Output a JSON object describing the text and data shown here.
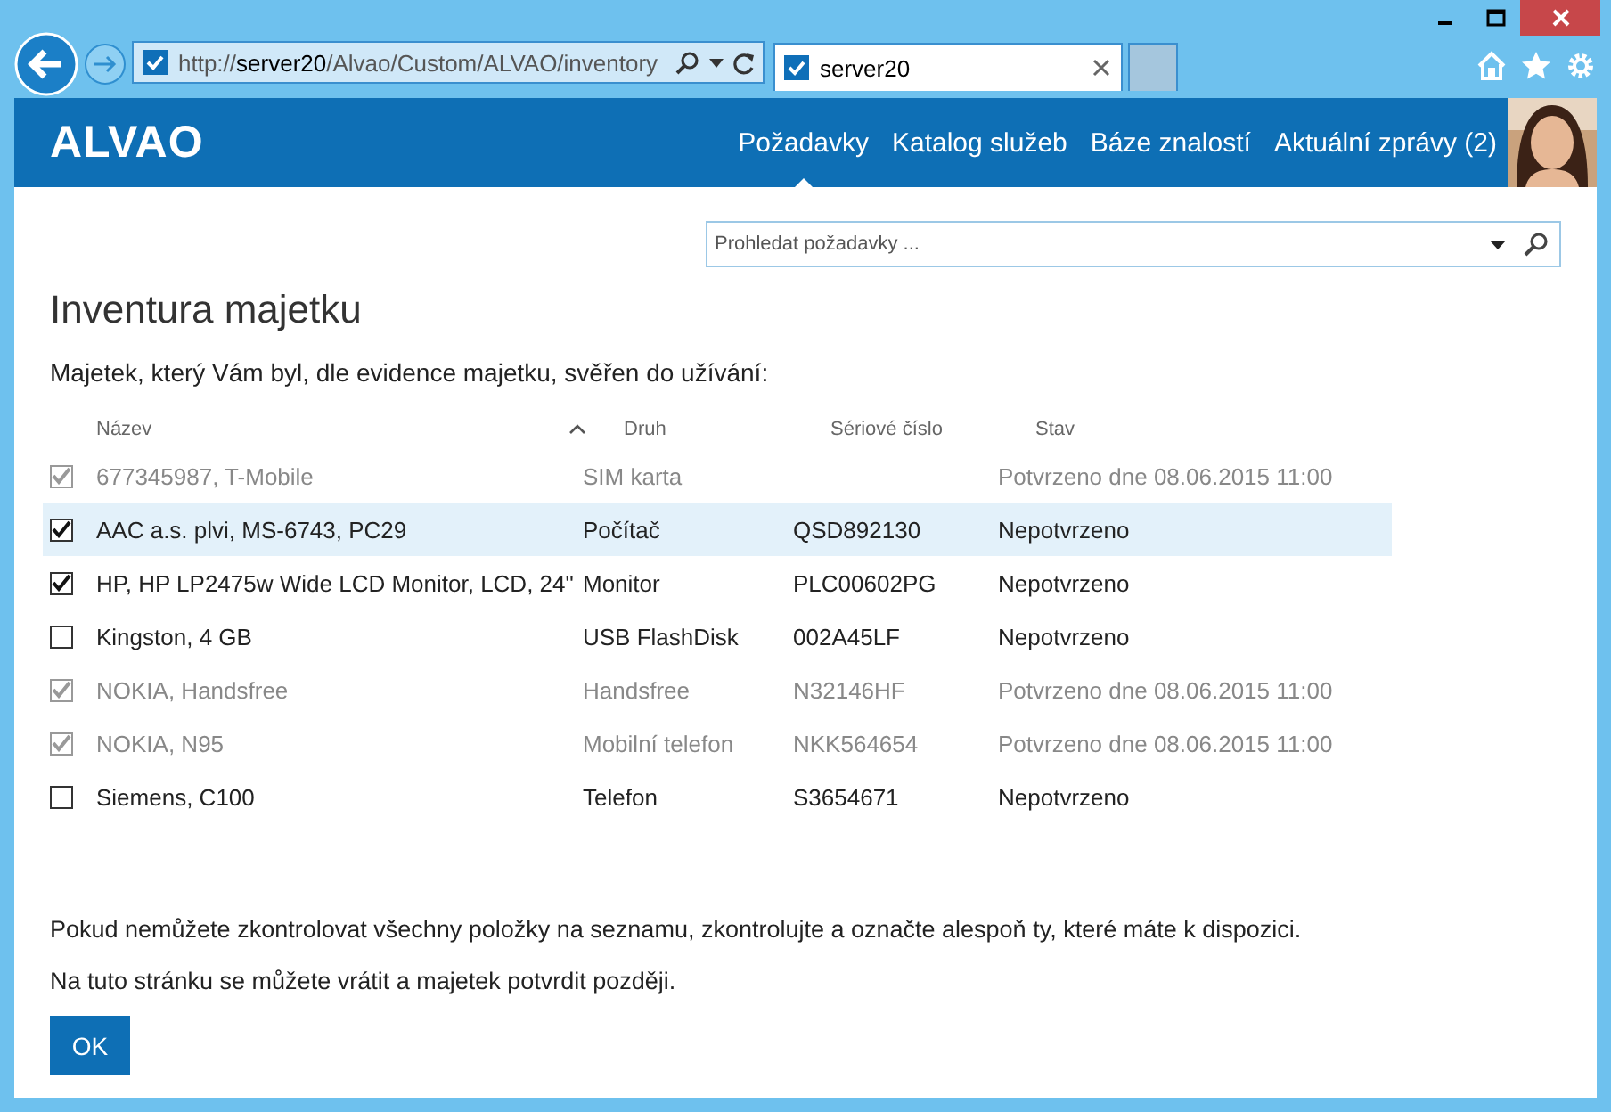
{
  "browser": {
    "address": "http://**server20**/Alvao/Custom/ALVAO/inventory",
    "tab": {
      "title": "server20",
      "selected": true
    }
  },
  "header": {
    "logo": "ALVAO",
    "nav": [
      {
        "label": "Požadavky",
        "selected": true
      },
      {
        "label": "Katalog služeb",
        "selected": false
      },
      {
        "label": "Báze znalostí",
        "selected": false
      },
      {
        "label": "Aktuální zprávy (2)",
        "selected": false
      }
    ]
  },
  "search": {
    "placeholder": "Prohledat požadavky ..."
  },
  "title": "Inventura majetku",
  "intro": "Majetek, který Vám byl, dle evidence majetku, svěřen do užívání:",
  "table": {
    "columns": [
      "Název",
      "Druh",
      "Sériové číslo",
      "Stav"
    ],
    "rows": [
      {
        "name": "677345987, T-Mobile",
        "type": "SIM karta",
        "serial": "",
        "status": "Potvrzeno dne 08.06.2015 11:00",
        "checked": true,
        "disabled": true,
        "selected": false
      },
      {
        "name": "AAC a.s. plvi, MS-6743, PC29",
        "type": "Počítač",
        "serial": "QSD892130",
        "status": "Nepotvrzeno",
        "checked": true,
        "disabled": false,
        "selected": true
      },
      {
        "name": "HP, HP LP2475w Wide LCD Monitor, LCD, 24\"",
        "type": "Monitor",
        "serial": "PLC00602PG",
        "status": "Nepotvrzeno",
        "checked": true,
        "disabled": false,
        "selected": false
      },
      {
        "name": "Kingston, 4 GB",
        "type": "USB FlashDisk",
        "serial": "002A45LF",
        "status": "Nepotvrzeno",
        "checked": false,
        "disabled": false,
        "selected": false
      },
      {
        "name": "NOKIA, Handsfree",
        "type": "Handsfree",
        "serial": "N32146HF",
        "status": "Potvrzeno dne 08.06.2015 11:00",
        "checked": true,
        "disabled": true,
        "selected": false
      },
      {
        "name": "NOKIA, N95",
        "type": "Mobilní telefon",
        "serial": "NKK564654",
        "status": "Potvrzeno dne 08.06.2015 11:00",
        "checked": true,
        "disabled": true,
        "selected": false
      },
      {
        "name": "Siemens, C100",
        "type": "Telefon",
        "serial": "S3654671",
        "status": "Nepotvrzeno",
        "checked": false,
        "disabled": false,
        "selected": false
      }
    ]
  },
  "notes": [
    "Pokud nemůžete zkontrolovat všechny položky na seznamu, zkontrolujte a označte alespoň ty, které máte k dispozici.",
    "Na tuto stránku se můžete vrátit a majetek potvrdit později."
  ],
  "ok_button": "OK"
}
